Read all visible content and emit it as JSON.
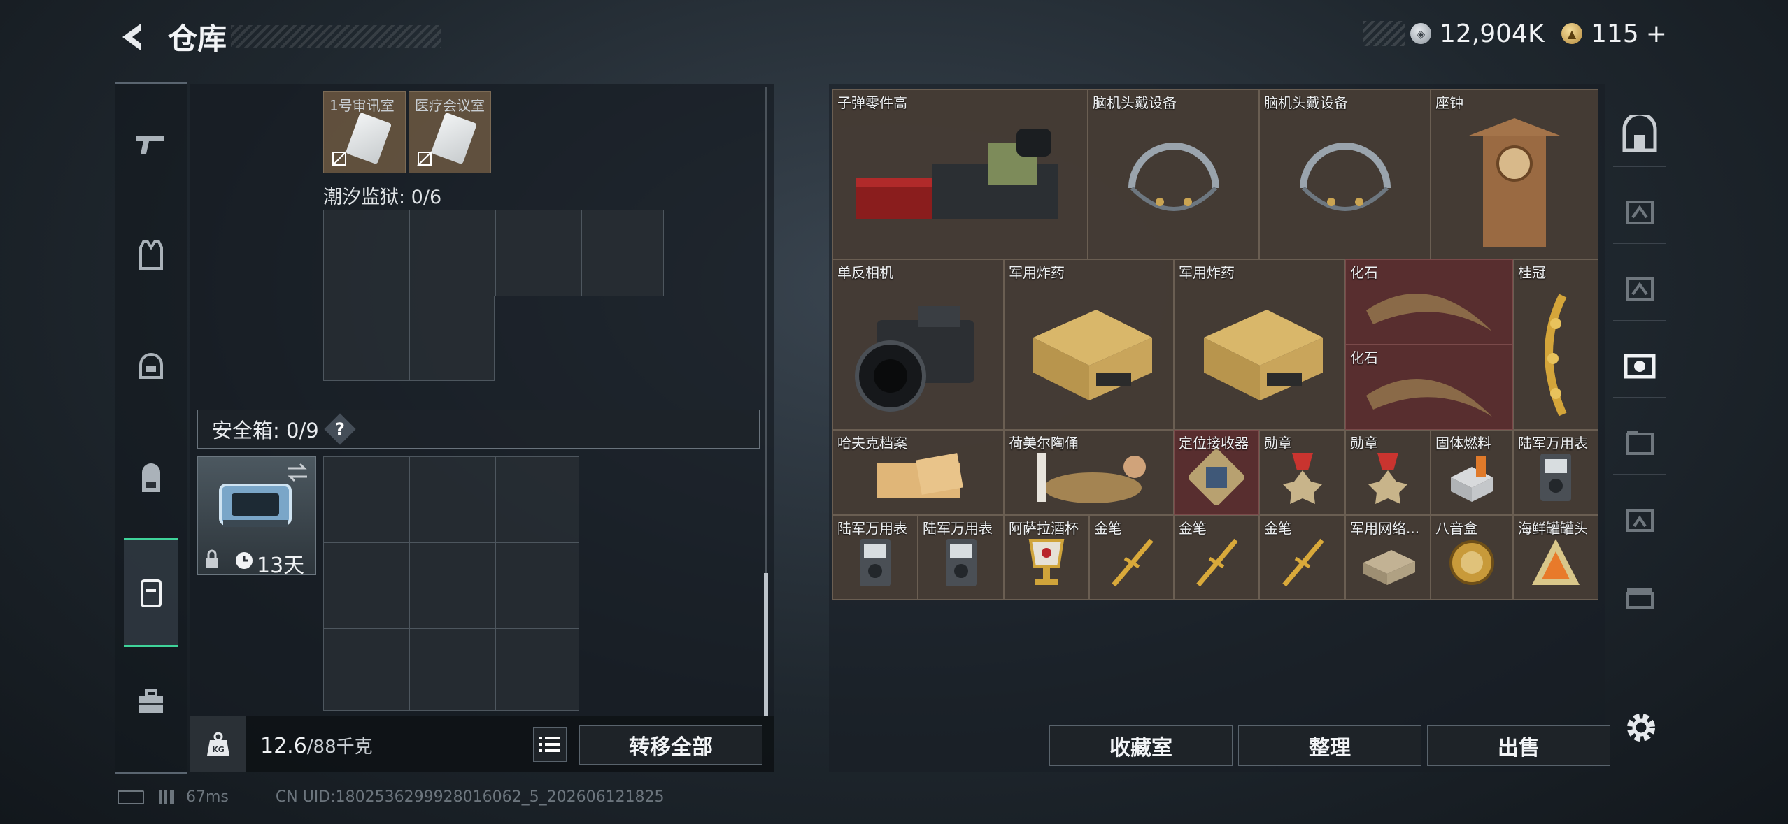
{
  "header": {
    "title": "仓库",
    "currency_silver": "12,904K",
    "currency_gold": "115",
    "gold_add": "+"
  },
  "left_panel": {
    "tiny_items": [
      {
        "label": "1号审讯室"
      },
      {
        "label": "医疗会议室"
      }
    ],
    "tidal_prison_label": "潮汐监狱: 0/6",
    "safebox_label": "安全箱: 0/9",
    "help_label": "?",
    "safebox_timer": "13天",
    "weight_value": "12.6",
    "weight_capacity": "/88千克",
    "transfer_all": "转移全部"
  },
  "stash": {
    "items": [
      {
        "name": "子弹零件高"
      },
      {
        "name": "脑机头戴设备"
      },
      {
        "name": "脑机头戴设备"
      },
      {
        "name": "座钟"
      },
      {
        "name": "单反相机"
      },
      {
        "name": "军用炸药"
      },
      {
        "name": "军用炸药"
      },
      {
        "name": "化石"
      },
      {
        "name": "化石"
      },
      {
        "name": "桂冠"
      },
      {
        "name": "哈夫克档案"
      },
      {
        "name": "荷美尔陶俑"
      },
      {
        "name": "定位接收器"
      },
      {
        "name": "勋章"
      },
      {
        "name": "勋章"
      },
      {
        "name": "固体燃料"
      },
      {
        "name": "陆军万用表"
      },
      {
        "name": "陆军万用表"
      },
      {
        "name": "陆军万用表"
      },
      {
        "name": "阿萨拉酒杯"
      },
      {
        "name": "金笔"
      },
      {
        "name": "金笔"
      },
      {
        "name": "金笔"
      },
      {
        "name": "军用网络..."
      },
      {
        "name": "八音盒"
      },
      {
        "name": "海鲜罐罐头"
      }
    ]
  },
  "buttons": {
    "collection": "收藏室",
    "organize": "整理",
    "sell": "出售"
  },
  "status_bar": {
    "ping": "67ms",
    "uid": "CN UID:1802536299928016062_5_202606121825"
  },
  "colors": {
    "accent_green": "#3fd39a",
    "red_slot": "#643032"
  }
}
